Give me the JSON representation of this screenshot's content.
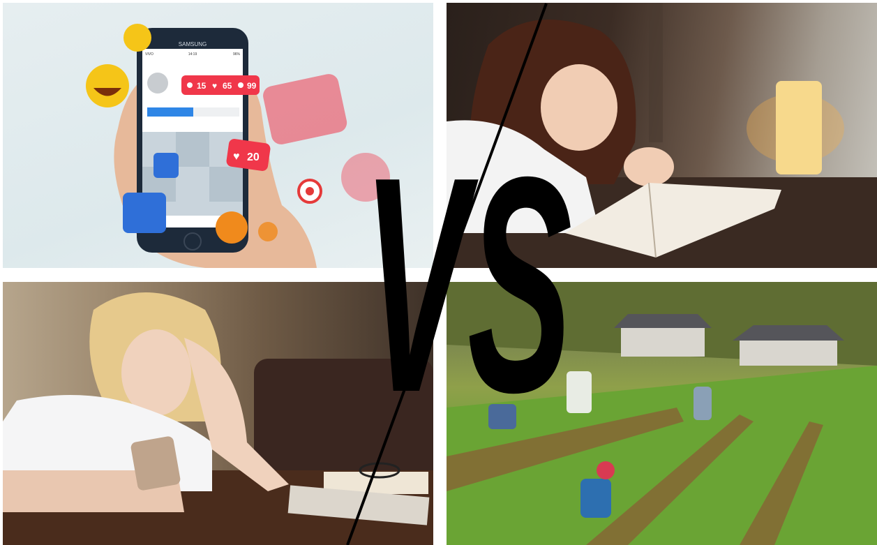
{
  "phone": {
    "brand": "SAMSUNG",
    "carrier": "VIVO",
    "time": "14:19",
    "battery": "96%",
    "followers": "15",
    "likes": "65",
    "comments": "99",
    "like_bubble": "20"
  },
  "overlay": {
    "text": "VS"
  },
  "colors": {
    "notification_red": "#f0374a",
    "like_blue": "#2f6fd8",
    "vs_black": "#000000"
  }
}
